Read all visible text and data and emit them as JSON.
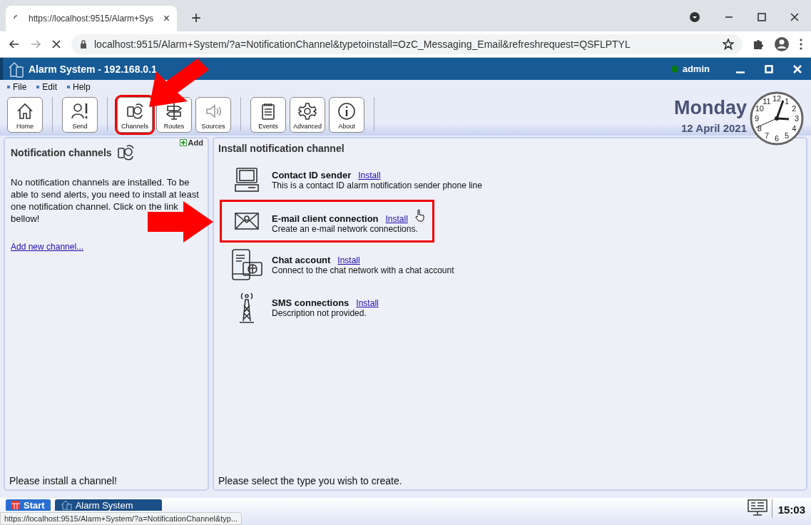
{
  "browser": {
    "tab_title": "https://localhost:9515/Alarm+Sys",
    "tab_close": "×",
    "new_tab": "+",
    "address": "localhost:9515/Alarm+System/?a=NotificationChannel&typetoinstall=OzC_Messaging_Email&refreshrequest=QSFLPTYL",
    "loading": true
  },
  "app": {
    "title": "Alarm System - 192.168.0.1",
    "user": "admin",
    "online": true
  },
  "menu": [
    "File",
    "Edit",
    "Help"
  ],
  "toolbar": [
    [
      {
        "kind": "home",
        "label": "Home",
        "disabled": false,
        "highlighted": false
      }
    ],
    [
      {
        "kind": "send",
        "label": "Send",
        "disabled": false,
        "highlighted": false
      }
    ],
    [
      {
        "kind": "channels",
        "label": "Channels",
        "disabled": false,
        "highlighted": true
      },
      {
        "kind": "routes",
        "label": "Routes",
        "disabled": false,
        "highlighted": false
      },
      {
        "kind": "sources",
        "label": "Sources",
        "disabled": true,
        "highlighted": false
      }
    ],
    [
      {
        "kind": "events",
        "label": "Events",
        "disabled": false,
        "highlighted": false
      },
      {
        "kind": "advanced",
        "label": "Advanced",
        "disabled": false,
        "highlighted": false
      },
      {
        "kind": "about",
        "label": "About",
        "disabled": false,
        "highlighted": false
      }
    ]
  ],
  "date": {
    "day": "Monday",
    "date": "12 April 2021"
  },
  "clock": {
    "numerals": [
      "11",
      "12",
      "1",
      "10",
      "2",
      "9",
      "3",
      "8",
      "4",
      "7",
      "6",
      "5"
    ]
  },
  "left_panel": {
    "title": "Notification channels",
    "add": "Add",
    "message": "No notification channels are installed. To be able to send alerts, you need to install at least one notification channel. Click on the link bellow!",
    "link": "Add new channel...",
    "footer": "Please install a channel!"
  },
  "right_panel": {
    "title": "Install notification channel",
    "channels": [
      {
        "kind": "computer",
        "name": "Contact ID sender",
        "action": "Install",
        "description": "This is a contact ID alarm notification sender phone line",
        "highlighted": false
      },
      {
        "kind": "email",
        "name": "E-mail client connection",
        "action": "Install",
        "description": "Create an e-mail network connections.",
        "highlighted": true
      },
      {
        "kind": "chat",
        "name": "Chat account",
        "action": "Install",
        "description": "Connect to the chat network with a chat account",
        "highlighted": false
      },
      {
        "kind": "sms",
        "name": "SMS connections",
        "action": "Install",
        "description": "Description not provided.",
        "highlighted": false
      }
    ],
    "footer": "Please select the type you wish to create."
  },
  "taskbar": {
    "start": "Start",
    "window": "Alarm System",
    "time": "15:03"
  },
  "status_url": "https://localhost:9515/Alarm+System/?a=NotificationChannel&typ...",
  "annotations": [
    {
      "kind": "arrow-down-left"
    },
    {
      "kind": "arrow-right"
    }
  ]
}
